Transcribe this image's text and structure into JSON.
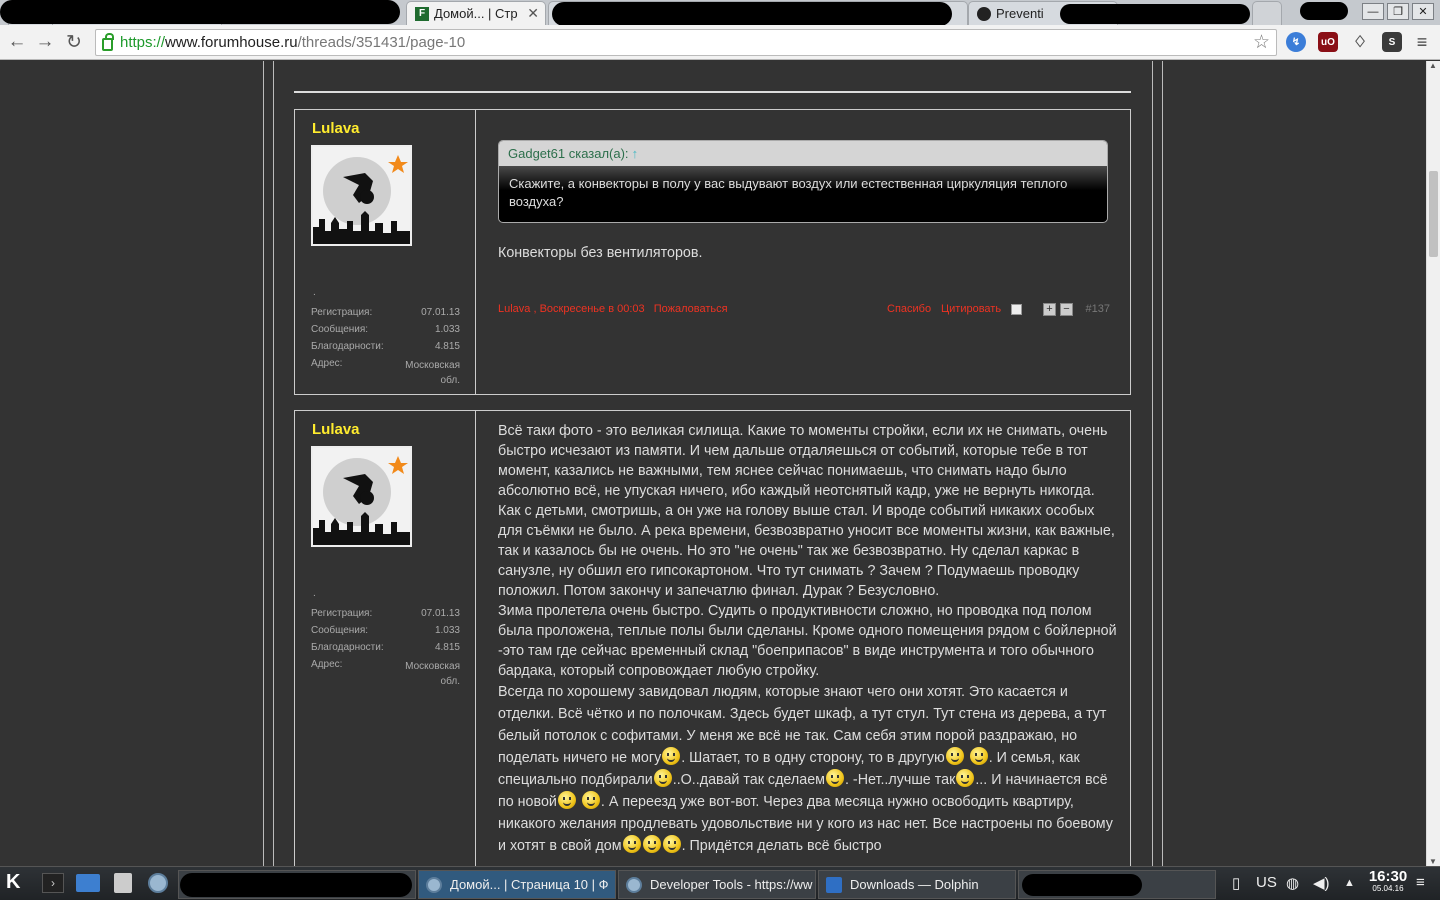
{
  "browser": {
    "tabs": [
      {
        "label": "Домой... | Стр"
      },
      {
        "label": "Preventi"
      }
    ],
    "url": {
      "scheme": "https://",
      "host": "www.forumhouse.ru",
      "path": "/threads/351431/page-10"
    }
  },
  "posts": [
    {
      "username": "Lulava",
      "dot": ".",
      "stats": [
        {
          "label": "Регистрация:",
          "value": "07.01.13"
        },
        {
          "label": "Сообщения:",
          "value": "1.033"
        },
        {
          "label": "Благодарности:",
          "value": "4.815"
        },
        {
          "label": "Адрес:",
          "value": "Московская обл."
        }
      ],
      "quote": {
        "author": "Gadget61 сказал(а):",
        "arrow": "↑",
        "text": "Скажите, а конвекторы в полу у вас выдувают воздух или естественная циркуляция теплого воздуха?"
      },
      "text": "Конвекторы без вентиляторов.",
      "footer": {
        "author": "Lulava",
        "date": "Воскресенье в 00:03",
        "report": "Пожаловаться",
        "thanks": "Спасибо",
        "quote_btn": "Цитировать",
        "number": "#137"
      }
    },
    {
      "username": "Lulava",
      "dot": ".",
      "stats": [
        {
          "label": "Регистрация:",
          "value": "07.01.13"
        },
        {
          "label": "Сообщения:",
          "value": "1.033"
        },
        {
          "label": "Благодарности:",
          "value": "4.815"
        },
        {
          "label": "Адрес:",
          "value": "Московская обл."
        }
      ],
      "p1": "Всё таки фото - это великая силища. Какие то моменты стройки, если их не снимать, очень быстро исчезают из памяти. И чем дальше отдаляешься от событий, которые тебе в тот момент, казались не важными, тем яснее сейчас понимаешь, что снимать надо было абсолютно всё, не упуская ничего, ибо каждый неотснятый кадр, уже не вернуть никогда. Как с детьми, смотришь, а он уже на голову выше стал. И вроде событий никаких особых для съёмки не было. А река времени, безвозвратно уносит все моменты жизни, как важные, так и казалось бы не очень. Но это \"не очень\" так же безвозвратно. Ну сделал каркас в санузле, ну обшил его гипсокартоном. Что тут снимать ? Зачем ? Подумаешь проводку положил. Потом закончу и запечатлю финал. Дурак ? Безусловно.",
      "p2": "Зима пролетела очень быстро. Судить о продуктивности сложно, но проводка под полом была проложена, теплые полы были сделаны. Кроме одного помещения рядом с бойлерной -это там где сейчас временный склад \"боеприпасов\" в виде инструмента и того обычного бардака, который сопровождает любую стройку.",
      "p3a": "Всегда по хорошему завидовал людям, которые знают чего они хотят. Это касается и отделки. Всё чётко и по полочкам. Здесь будет шкаф, а тут стул. Тут стена из дерева, а тут белый потолок с софитами. У меня же всё не так. Сам себя этим порой раздражаю, но поделать ничего не могу",
      "p3b": ". Шатает, то в одну сторону, то в другую",
      "p3c": ". И семья, как специально подбирали",
      "p3d": "..О..давай так сделаем",
      "p3e": ". -Нет..лучше так",
      "p3f": "... И начинается всё по новой",
      "p3g": ". А переезд уже вот-вот. Через два месяца нужно освободить квартиру, никакого желания продлевать удовольствие ни у кого из нас нет. Все настроены по боевому и хотят в свой дом",
      "p3h": ". Придётся делать всё быстро"
    }
  ],
  "taskbar": {
    "items": [
      {
        "label": "Домой... | Страница 10 | Ф"
      },
      {
        "label": "Developer Tools - https://ww"
      },
      {
        "label": "Downloads — Dolphin"
      }
    ],
    "layout": "US",
    "time": "16:30",
    "date": "05.04.16"
  },
  "colors": {
    "username": "#ffec2e",
    "link": "#e32222",
    "page_bg": "#333333"
  }
}
